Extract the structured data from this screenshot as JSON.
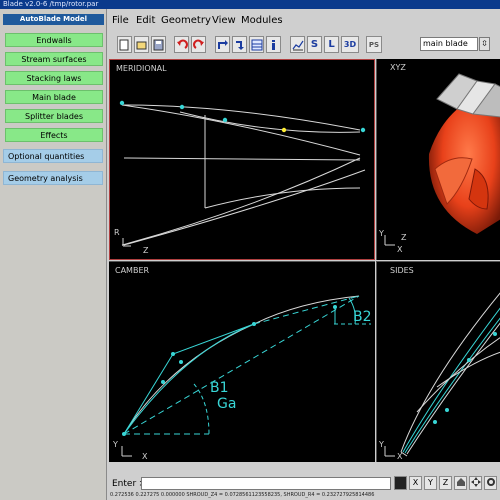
{
  "window": {
    "title": "Blade   v2.0-6   /tmp/rotor.par"
  },
  "sidebar": {
    "header": "AutoBlade Model",
    "items": [
      {
        "label": "Endwalls"
      },
      {
        "label": "Stream surfaces"
      },
      {
        "label": "Stacking laws"
      },
      {
        "label": "Main blade"
      },
      {
        "label": "Splitter blades"
      },
      {
        "label": "Effects"
      }
    ],
    "extras": [
      {
        "label": "Optional quantities"
      },
      {
        "label": "Geometry analysis"
      }
    ]
  },
  "menu": [
    "File",
    "Edit",
    "Geometry",
    "View",
    "Modules"
  ],
  "toolbar": {
    "text_buttons": {
      "s": "S",
      "l": "L",
      "three_d": "3D",
      "ps": "PS"
    },
    "combo_value": "main blade",
    "combo_arrow": "⇳"
  },
  "viewports": {
    "meridional": {
      "label": "MERIDIONAL",
      "axis_h": "Z",
      "axis_v": "R"
    },
    "xyz": {
      "label": "XYZ",
      "axis_h": "X",
      "axis_v": "Y",
      "axis_d": "Z"
    },
    "camber": {
      "label": "CAMBER",
      "axis_h": "X",
      "axis_v": "Y",
      "b1": "B1",
      "ga": "Ga",
      "b2": "B2"
    },
    "sides": {
      "label": "SIDES",
      "axis_h": "X",
      "axis_v": "Y"
    }
  },
  "statusbar": {
    "enter_label": "Enter >",
    "buttons": [
      "X",
      "Y",
      "Z"
    ],
    "text": "0.272536 0.227275 0.000000    SHROUD_Z4 = 0.0728561123558235, SHROUD_R4 = 0.232727925814486"
  },
  "colors": {
    "accent_cyan": "#38d6d6",
    "selected_point": "#ffee33",
    "button_green": "#88e888",
    "button_blue": "#a5cde8",
    "sidebar_header": "#1f5a9c"
  }
}
